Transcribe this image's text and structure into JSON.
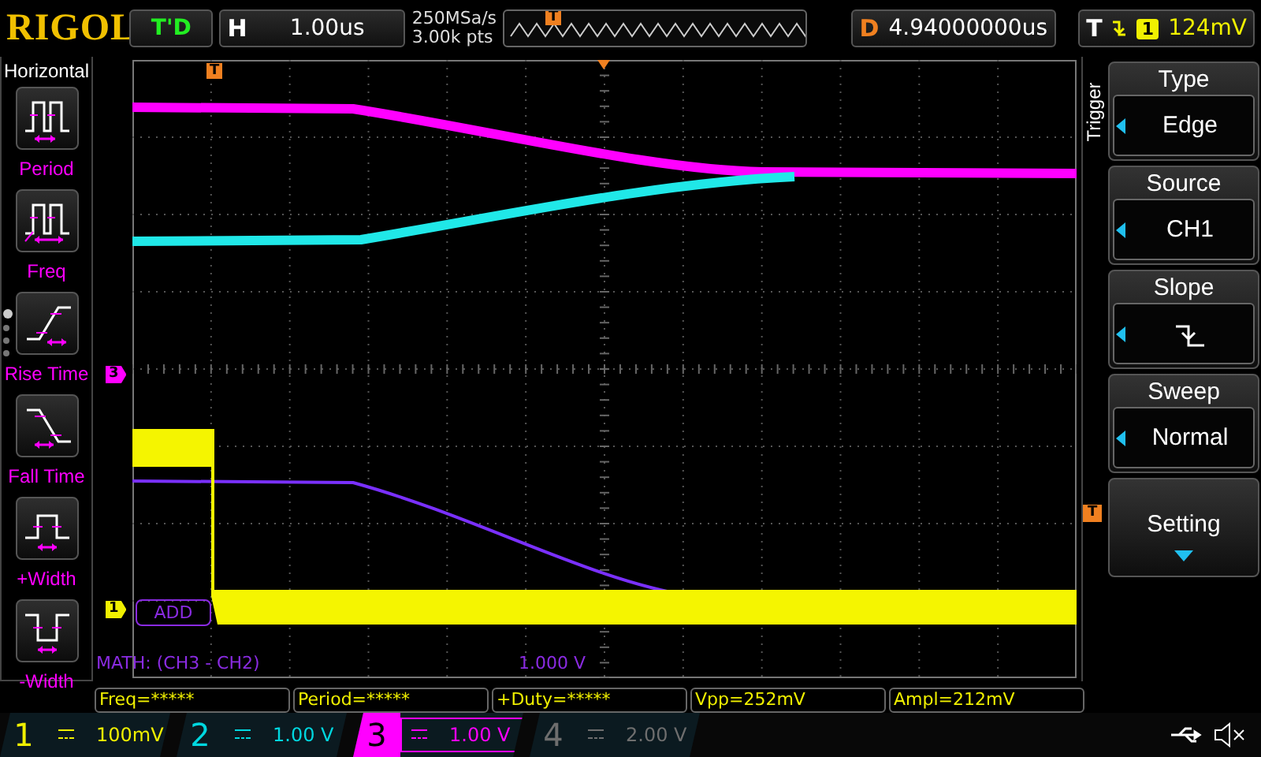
{
  "top_bar": {
    "brand": "RIGOL",
    "run_state": "T'D",
    "horizontal": {
      "label": "H",
      "value": "1.00us"
    },
    "sample_rate": "250MSa/s",
    "memory_depth": "3.00k pts",
    "trigger_position": "T",
    "delay": {
      "label": "D",
      "value": "4.94000000us"
    },
    "trigger": {
      "label": "T",
      "source": "1",
      "level": "124mV"
    }
  },
  "left_menu": {
    "title": "Horizontal",
    "items": [
      {
        "label": "Period",
        "kind": "period"
      },
      {
        "label": "Freq",
        "kind": "freq"
      },
      {
        "label": "Rise Time",
        "kind": "rise"
      },
      {
        "label": "Fall Time",
        "kind": "fall"
      },
      {
        "label": "+Width",
        "kind": "pwidth"
      },
      {
        "label": "-Width",
        "kind": "nwidth"
      }
    ],
    "pages": [
      {
        "selected": true
      },
      {
        "selected": false
      },
      {
        "selected": false
      },
      {
        "selected": false
      }
    ]
  },
  "plot": {
    "trigger_marker": "T",
    "ch3_marker": "3",
    "ch1_marker": "1",
    "trigger_level_marker": "T",
    "math_label": "ADD",
    "math_caption": "MATH: (CH3 - CH2)",
    "math_scale": "1.000 V"
  },
  "right_menu": {
    "title": "Trigger",
    "items": [
      {
        "title": "Type",
        "kind": "select",
        "value": "Edge"
      },
      {
        "title": "Source",
        "kind": "select",
        "value": "CH1"
      },
      {
        "title": "Slope",
        "kind": "slope"
      },
      {
        "title": "Sweep",
        "kind": "select",
        "value": "Normal"
      },
      {
        "title": "Setting",
        "kind": "submenu"
      }
    ]
  },
  "measurements": [
    "Freq=*****",
    "Period=*****",
    "+Duty=*****",
    "Vpp=252mV",
    "Ampl=212mV"
  ],
  "channels": [
    {
      "number": "1",
      "scale": "100mV",
      "color": "#f0f000",
      "selected": false
    },
    {
      "number": "2",
      "scale": "1.00 V",
      "color": "#00d8e0",
      "selected": false
    },
    {
      "number": "3",
      "scale": "1.00 V",
      "color": "#ff00ff",
      "selected": true
    },
    {
      "number": "4",
      "scale": "2.00 V",
      "color": "#6e6e6e",
      "selected": false
    }
  ]
}
